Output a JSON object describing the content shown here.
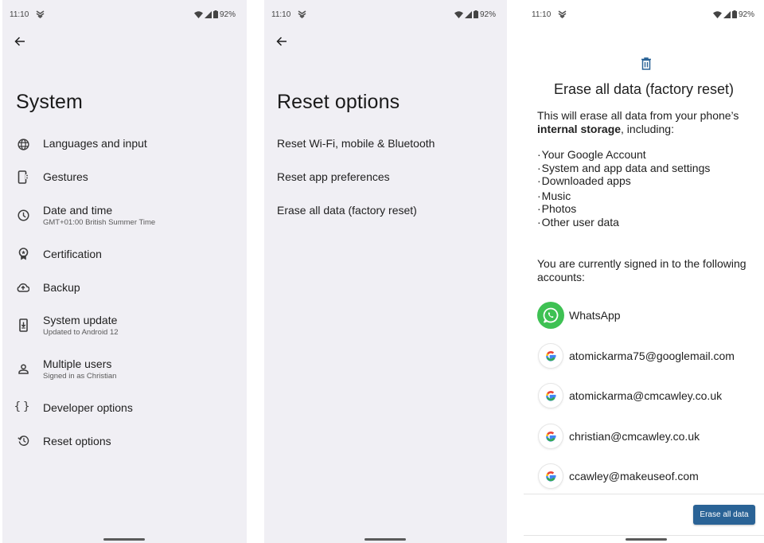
{
  "status_bar": {
    "time": "11:10",
    "battery": "92%",
    "icons": [
      "notification-app-icon",
      "wifi-icon",
      "cell-signal-icon",
      "battery-icon"
    ]
  },
  "system_screen": {
    "title": "System",
    "items": [
      {
        "label": "Languages and input",
        "sub": null,
        "icon": "globe-icon"
      },
      {
        "label": "Gestures",
        "sub": null,
        "icon": "gestures-phone-icon"
      },
      {
        "label": "Date and time",
        "sub": "GMT+01:00 British Summer Time",
        "icon": "clock-icon"
      },
      {
        "label": "Certification",
        "sub": null,
        "icon": "award-badge-icon"
      },
      {
        "label": "Backup",
        "sub": null,
        "icon": "cloud-upload-icon"
      },
      {
        "label": "System update",
        "sub": "Updated to Android 12",
        "icon": "system-update-icon"
      },
      {
        "label": "Multiple users",
        "sub": "Signed in as Christian",
        "icon": "person-icon"
      },
      {
        "label": "Developer options",
        "sub": null,
        "icon": "braces-icon"
      },
      {
        "label": "Reset options",
        "sub": null,
        "icon": "history-icon"
      }
    ]
  },
  "reset_screen": {
    "title": "Reset options",
    "items": [
      {
        "label": "Reset Wi-Fi, mobile & Bluetooth"
      },
      {
        "label": "Reset app preferences"
      },
      {
        "label": "Erase all data (factory reset)"
      }
    ]
  },
  "erase_screen": {
    "title": "Erase all data (factory reset)",
    "desc_prefix": "This will erase all data from your phone’s ",
    "desc_bold": "internal storage",
    "desc_suffix": ", including:",
    "items": [
      "Your Google Account",
      "System and app data and settings",
      "Downloaded apps",
      "Music",
      "Photos",
      "Other user data"
    ],
    "accounts_intro": "You are currently signed in to the following accounts:",
    "accounts": [
      {
        "label": "WhatsApp",
        "type": "whatsapp"
      },
      {
        "label": "atomickarma75@googlemail.com",
        "type": "google"
      },
      {
        "label": "atomickarma@cmcawley.co.uk",
        "type": "google"
      },
      {
        "label": "christian@cmcawley.co.uk",
        "type": "google"
      },
      {
        "label": "ccawley@makeuseof.com",
        "type": "google"
      }
    ],
    "button_label": "Erase all data",
    "accent_color": "#2a6396"
  }
}
